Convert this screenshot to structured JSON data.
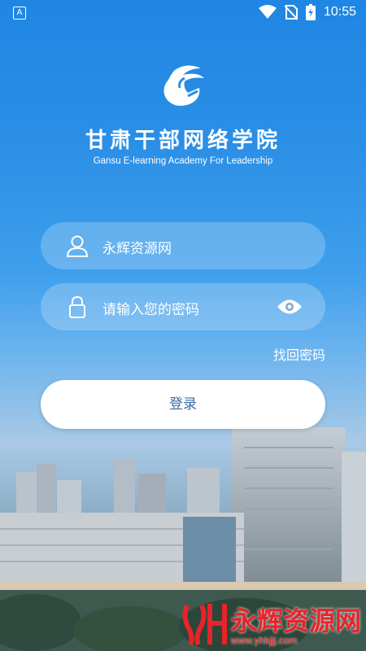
{
  "status_bar": {
    "time": "10:55",
    "icons": [
      "app-notification-icon",
      "wifi-icon",
      "no-sim-icon",
      "battery-charging-icon"
    ]
  },
  "header": {
    "title": "甘肃干部网络学院",
    "subtitle": "Gansu E-learning Academy For Leadership"
  },
  "form": {
    "username_value": "永辉资源网",
    "password_placeholder": "请输入您的密码",
    "forgot_label": "找回密码",
    "login_label": "登录"
  },
  "watermark": {
    "name": "永辉资源网",
    "url": "www.yhkjjj.com"
  },
  "colors": {
    "sky_top": "#1f86e3",
    "button_text": "#3a6aa8",
    "watermark": "#e8232a"
  }
}
